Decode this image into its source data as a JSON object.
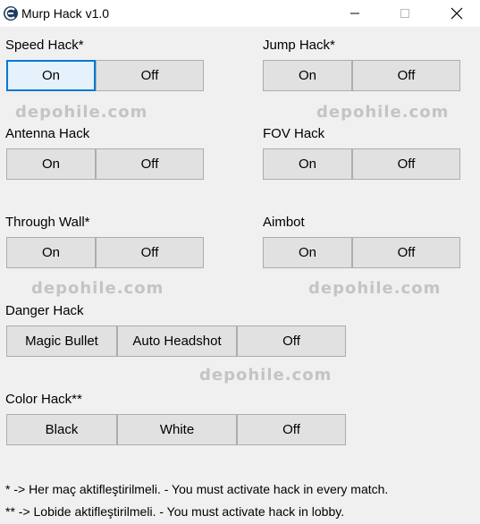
{
  "window": {
    "title": "Murp Hack v1.0",
    "icon": "cheat-engine-icon",
    "controls": [
      "minimize-icon",
      "maximize-icon",
      "close-icon"
    ]
  },
  "groups": {
    "speed": {
      "label": "Speed Hack*",
      "on": "On",
      "off": "Off"
    },
    "jump": {
      "label": "Jump Hack*",
      "on": "On",
      "off": "Off"
    },
    "antenna": {
      "label": "Antenna Hack",
      "on": "On",
      "off": "Off"
    },
    "fov": {
      "label": "FOV Hack",
      "on": "On",
      "off": "Off"
    },
    "through_wall": {
      "label": "Through Wall*",
      "on": "On",
      "off": "Off"
    },
    "aimbot": {
      "label": "Aimbot",
      "on": "On",
      "off": "Off"
    },
    "danger": {
      "label": "Danger Hack",
      "opt1": "Magic Bullet",
      "opt2": "Auto Headshot",
      "off": "Off"
    },
    "color": {
      "label": "Color Hack**",
      "opt1": "Black",
      "opt2": "White",
      "off": "Off"
    }
  },
  "watermark": "depohile.com",
  "notes": {
    "single": "* -> Her maç aktifleştirilmeli. - You must activate hack in every match.",
    "double": "** -> Lobide aktifleştirilmeli. - You must activate hack in lobby."
  },
  "colors": {
    "focus_border": "#0078d7",
    "button_bg": "#e1e1e1",
    "window_bg": "#f0f0f0",
    "watermark": "#c4c4c4"
  }
}
